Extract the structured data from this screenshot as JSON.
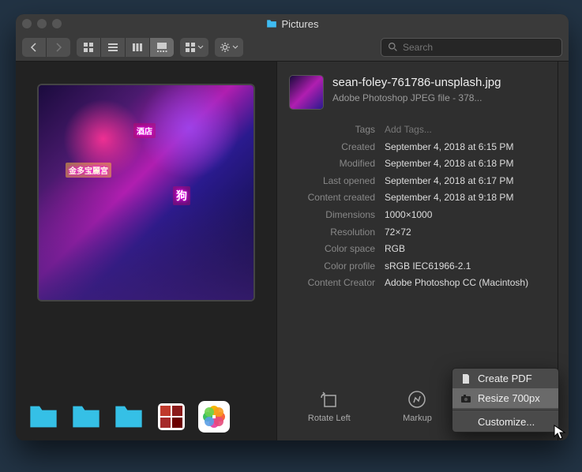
{
  "window": {
    "title": "Pictures"
  },
  "toolbar": {
    "search_placeholder": "Search"
  },
  "file": {
    "name": "sean-foley-761786-unsplash.jpg",
    "subtitle": "Adobe Photoshop JPEG file - 378..."
  },
  "meta": {
    "tags_label": "Tags",
    "tags_value": "Add Tags...",
    "created_label": "Created",
    "created_value": "September 4, 2018 at 6:15 PM",
    "modified_label": "Modified",
    "modified_value": "September 4, 2018 at 6:18 PM",
    "last_opened_label": "Last opened",
    "last_opened_value": "September 4, 2018 at 6:17 PM",
    "content_created_label": "Content created",
    "content_created_value": "September 4, 2018 at 9:18 PM",
    "dimensions_label": "Dimensions",
    "dimensions_value": "1000×1000",
    "resolution_label": "Resolution",
    "resolution_value": "72×72",
    "color_space_label": "Color space",
    "color_space_value": "RGB",
    "color_profile_label": "Color profile",
    "color_profile_value": "sRGB IEC61966-2.1",
    "content_creator_label": "Content Creator",
    "content_creator_value": "Adobe Photoshop CC (Macintosh)"
  },
  "actions": {
    "rotate_left": "Rotate Left",
    "markup": "Markup",
    "more": ""
  },
  "popup": {
    "create_pdf": "Create PDF",
    "resize": "Resize 700px",
    "customize": "Customize..."
  }
}
